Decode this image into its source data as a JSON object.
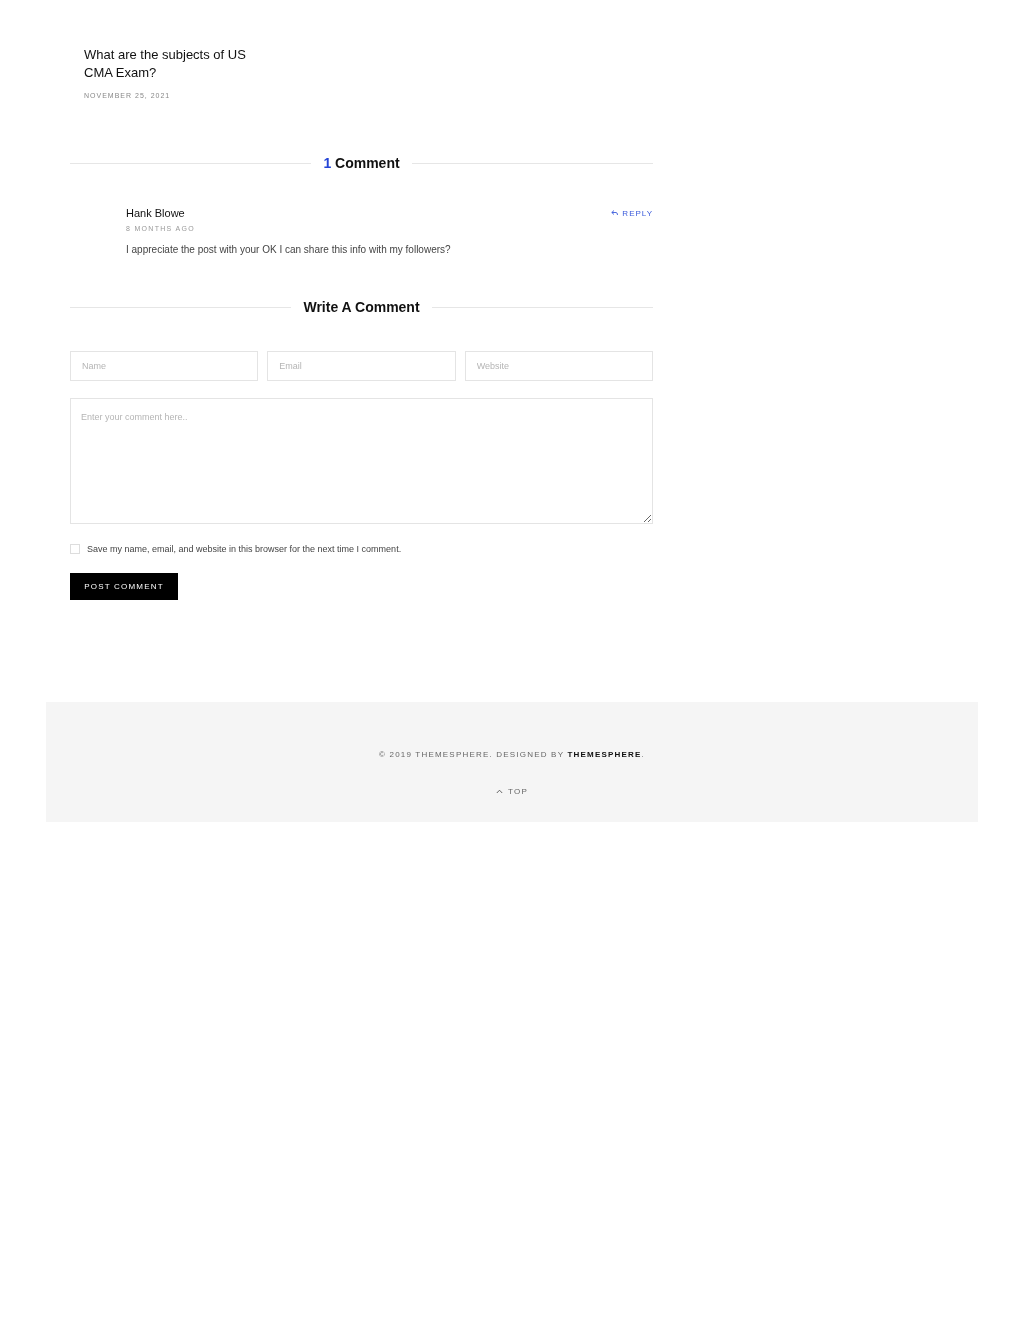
{
  "related_post": {
    "title": "What are the subjects of US CMA Exam?",
    "date": "NOVEMBER 25, 2021"
  },
  "comments_section": {
    "count": "1",
    "heading": "Comment",
    "comments": [
      {
        "author": "Hank Blowe",
        "time": "8 MONTHS AGO",
        "reply": "REPLY",
        "text": "I appreciate the post with your OK I can share this info with my followers?"
      }
    ]
  },
  "comment_form": {
    "heading": "Write A Comment",
    "fields": [
      {
        "placeholder": "Name"
      },
      {
        "placeholder": "Email"
      },
      {
        "placeholder": "Website"
      }
    ],
    "comment_placeholder": "Enter your comment here..",
    "save_info": {
      "label": "Save my name, email, and website in this browser for the next time I comment.",
      "checked": false
    },
    "submit": "POST COMMENT"
  },
  "footer": {
    "copyright": "© 2019 THEMESPHERE. DESIGNED BY ",
    "link": "THEMESPHERE",
    "after": ".",
    "top": "TOP"
  }
}
